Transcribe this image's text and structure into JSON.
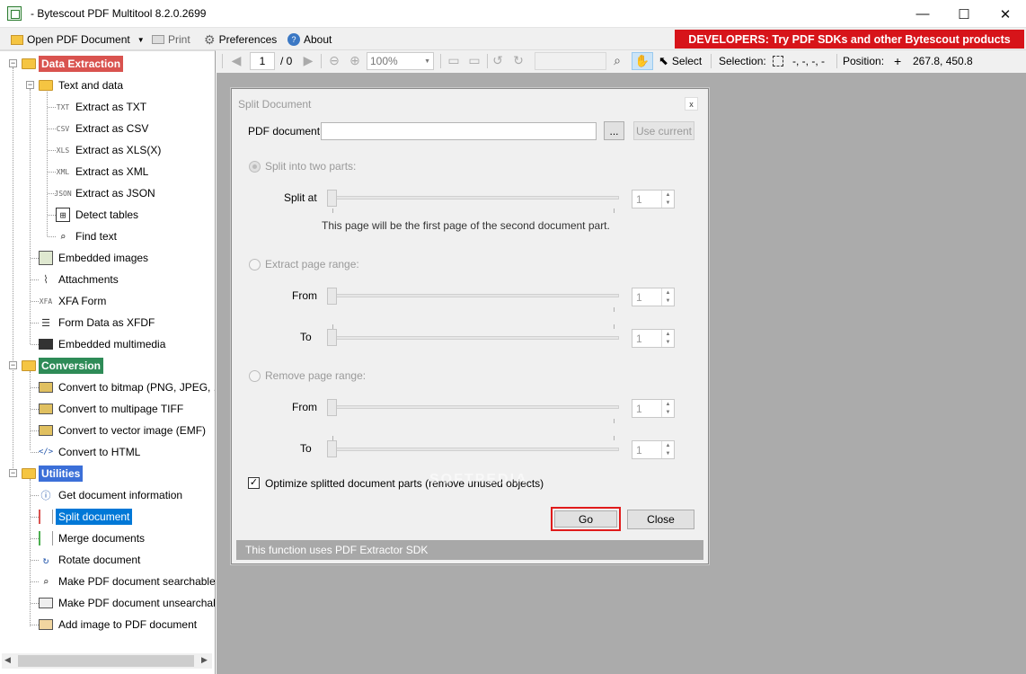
{
  "window": {
    "title": "- Bytescout PDF Multitool 8.2.0.2699",
    "minimize": "—",
    "maximize": "☐",
    "close": "✕"
  },
  "menubar": {
    "open": "Open PDF Document",
    "print": "Print",
    "preferences": "Preferences",
    "about": "About",
    "banner": "DEVELOPERS: Try PDF SDKs and other Bytescout products"
  },
  "viewbar": {
    "page": "1",
    "page_total": "/ 0",
    "zoom": "100%",
    "select": "Select",
    "selection_label": "Selection:",
    "selection_value": "-, -, -, -",
    "position_label": "Position:",
    "position_value": "267.8, 450.8"
  },
  "tree": {
    "data_extraction": "Data Extraction",
    "text_and_data": "Text and data",
    "extract_txt": "Extract as TXT",
    "extract_csv": "Extract as CSV",
    "extract_xls": "Extract as XLS(X)",
    "extract_xml": "Extract as XML",
    "extract_json": "Extract as JSON",
    "detect_tables": "Detect tables",
    "find_text": "Find text",
    "embedded_images": "Embedded images",
    "attachments": "Attachments",
    "xfa_form": "XFA Form",
    "form_data_xfdf": "Form Data as XFDF",
    "embedded_multimedia": "Embedded multimedia",
    "conversion": "Conversion",
    "convert_bitmap": "Convert to bitmap (PNG, JPEG, ...)",
    "convert_tiff": "Convert to multipage TIFF",
    "convert_emf": "Convert to vector image (EMF)",
    "convert_html": "Convert to HTML",
    "utilities": "Utilities",
    "get_info": "Get document information",
    "split": "Split document",
    "merge": "Merge documents",
    "rotate": "Rotate document",
    "searchable": "Make PDF document searchable",
    "unsearchable": "Make PDF document unsearchable",
    "add_image": "Add image to PDF document",
    "colors": {
      "data_extraction": "#d9534f",
      "conversion": "#2e8b57",
      "utilities": "#3b6fd8",
      "selected": "#0078d7"
    },
    "icons": {
      "txt": "TXT",
      "csv": "CSV",
      "xls": "XLS",
      "xml": "XML",
      "json": "JSON",
      "xfa": "XFA"
    }
  },
  "dialog": {
    "title": "Split Document",
    "close": "x",
    "pdf_label": "PDF document",
    "pdf_value": "",
    "browse": "...",
    "use_current": "Use current",
    "split_two": "Split into two parts:",
    "split_at": "Split at",
    "split_value": "1",
    "split_hint": "This page will be the first page of the second document part.",
    "extract_range": "Extract page range:",
    "from": "From",
    "to": "To",
    "from1_value": "1",
    "to1_value": "1",
    "remove_range": "Remove page range:",
    "from2_value": "1",
    "to2_value": "1",
    "optimize": "Optimize splitted document parts (remove unused objects)",
    "go": "Go",
    "close_btn": "Close",
    "footer": "This function uses PDF Extractor SDK",
    "watermark": "SOFTPEDIA"
  }
}
